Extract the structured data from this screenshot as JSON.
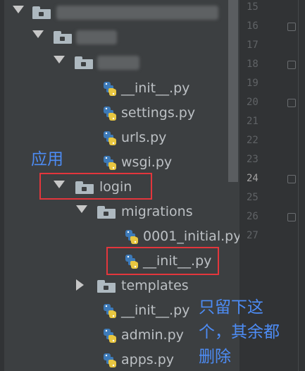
{
  "tree": {
    "items": [
      {
        "label": "__init__.py"
      },
      {
        "label": "settings.py"
      },
      {
        "label": "urls.py"
      },
      {
        "label": "wsgi.py"
      },
      {
        "label": "login"
      },
      {
        "label": "migrations"
      },
      {
        "label": "0001_initial.py"
      },
      {
        "label": "__init__.py"
      },
      {
        "label": "templates"
      },
      {
        "label": "__init__.py"
      },
      {
        "label": "admin.py"
      },
      {
        "label": "apps.py"
      }
    ]
  },
  "gutter": {
    "lines": [
      "15",
      "16",
      "17",
      "18",
      "19",
      "20",
      "21",
      "22",
      "23",
      "24",
      "25",
      "26",
      "27"
    ],
    "active_line": "24"
  },
  "annotations": {
    "app": "应用",
    "keep_line1": "只留下这",
    "keep_line2": "个，其余都",
    "keep_line3": "删除"
  },
  "colors": {
    "highlight_box": "#e3363c",
    "annotation_text": "#4d8cf5"
  }
}
